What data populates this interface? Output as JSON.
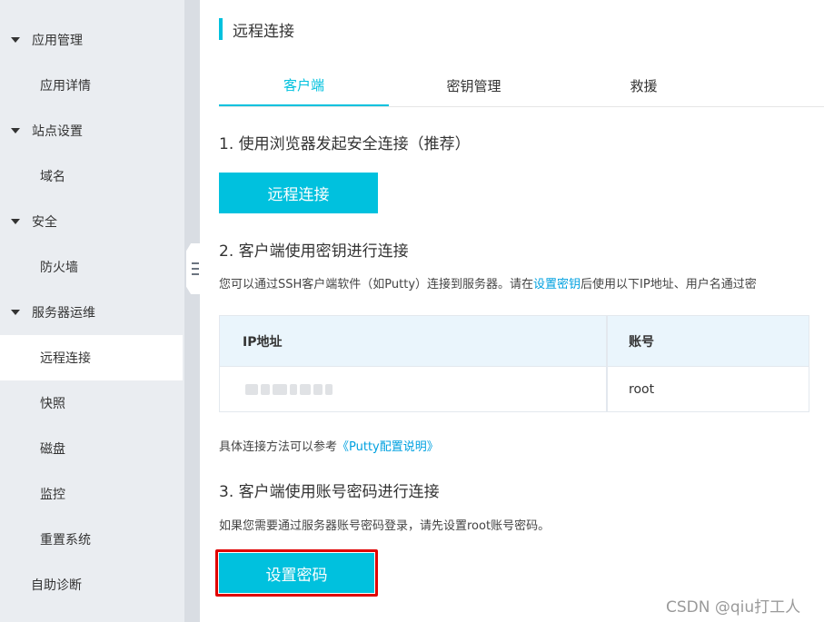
{
  "sidebar": {
    "items": [
      {
        "label": "应用管理"
      },
      {
        "label": "应用详情"
      },
      {
        "label": "站点设置"
      },
      {
        "label": "域名"
      },
      {
        "label": "安全"
      },
      {
        "label": "防火墙"
      },
      {
        "label": "服务器运维"
      },
      {
        "label": "远程连接"
      },
      {
        "label": "快照"
      },
      {
        "label": "磁盘"
      },
      {
        "label": "监控"
      },
      {
        "label": "重置系统"
      },
      {
        "label": "自助诊断"
      }
    ]
  },
  "page": {
    "title": "远程连接",
    "tabs": [
      {
        "label": "客户端"
      },
      {
        "label": "密钥管理"
      },
      {
        "label": "救援"
      }
    ],
    "section1": {
      "heading": "1. 使用浏览器发起安全连接（推荐）",
      "button": "远程连接"
    },
    "section2": {
      "heading": "2. 客户端使用密钥进行连接",
      "desc_pre": "您可以通过SSH客户端软件（如Putty）连接到服务器。请在",
      "desc_link": "设置密钥",
      "desc_post": "后使用以下IP地址、用户名通过密",
      "table": {
        "headers": [
          "IP地址",
          "账号"
        ],
        "account": "root"
      },
      "ref_pre": "具体连接方法可以参考",
      "ref_link": "《Putty配置说明》"
    },
    "section3": {
      "heading": "3. 客户端使用账号密码进行连接",
      "desc": "如果您需要通过服务器账号密码登录，请先设置root账号密码。",
      "button": "设置密码"
    }
  },
  "watermark": "CSDN @qiu打工人",
  "colors": {
    "accent": "#00c1de",
    "link": "#00a1e0",
    "highlight": "#e00000"
  }
}
